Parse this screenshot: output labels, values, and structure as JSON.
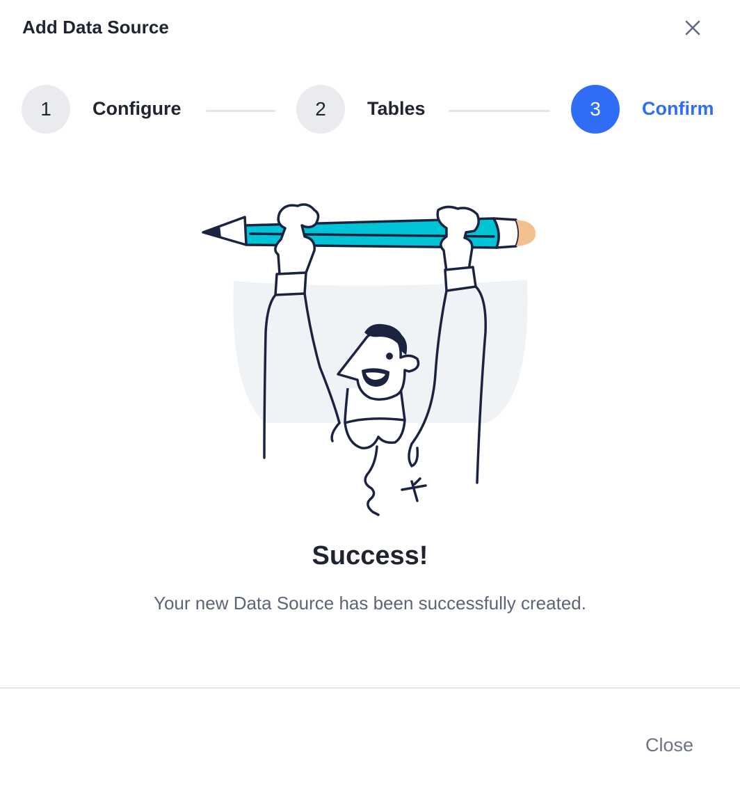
{
  "dialog": {
    "title": "Add Data Source",
    "close_icon": "close-icon"
  },
  "stepper": {
    "steps": [
      {
        "number": "1",
        "label": "Configure",
        "state": "completed"
      },
      {
        "number": "2",
        "label": "Tables",
        "state": "completed"
      },
      {
        "number": "3",
        "label": "Confirm",
        "state": "active"
      }
    ]
  },
  "illustration": {
    "name": "person-hanging-from-pencil-illustration"
  },
  "result": {
    "title": "Success!",
    "message": "Your new Data Source has been successfully created."
  },
  "footer": {
    "close_label": "Close"
  },
  "colors": {
    "accent": "#2f6df6",
    "inactive_step": "#eaebef",
    "pencil": "#00c4d6",
    "eraser": "#f2c08f",
    "backdrop": "#f0f3f6"
  }
}
